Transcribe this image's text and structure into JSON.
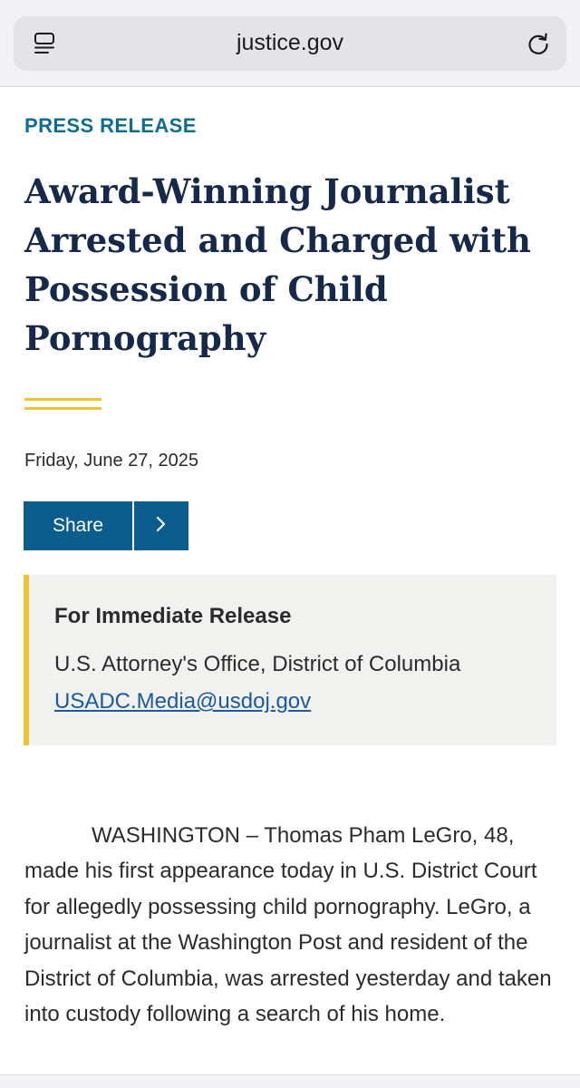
{
  "browser": {
    "url": "justice.gov",
    "icons": {
      "reader": "reader-view-icon",
      "reload": "reload-icon"
    }
  },
  "article": {
    "eyebrow": "PRESS RELEASE",
    "title": "Award-Winning Journalist Arrested and Charged with Possession of Child Pornography",
    "date": "Friday, June 27, 2025",
    "share": {
      "label": "Share",
      "icon": "chevron-right-icon"
    },
    "release": {
      "heading": "For Immediate Release",
      "office": "U.S. Attorney's Office, District of Columbia",
      "email": "USADC.Media@usdoj.gov"
    },
    "body": "WASHINGTON – Thomas Pham LeGro, 48, made his first appearance today in U.S. District Court for allegedly possessing child pornography. LeGro, a journalist at the Washington Post and resident of the District of Columbia, was arrested yesterday and taken into custody following a search of his home."
  },
  "colors": {
    "eyebrow": "#0f6d93",
    "headline": "#17294a",
    "accent_gold": "#f1c233",
    "share_bg": "#0a5d8c",
    "link": "#1a5aa0",
    "release_box_bg": "#f1f1ef"
  }
}
